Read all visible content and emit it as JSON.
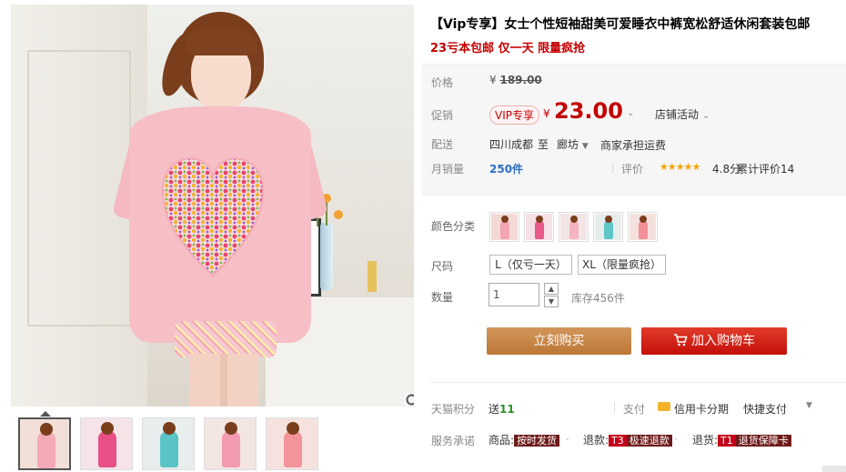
{
  "product": {
    "title": "【Vip专享】女士个性短袖甜美可爱睡衣中裤宽松舒适休闲套装包邮",
    "subtitle": "23亏本包邮 仅一天 限量疯抢"
  },
  "price": {
    "label": "价格",
    "currency": "¥",
    "original": "189.00"
  },
  "promo": {
    "label": "促销",
    "vip_tag": "VIP专享",
    "currency": "¥",
    "price": "23.00",
    "store_event": "店铺活动"
  },
  "shipping": {
    "label": "配送",
    "from": "四川成都",
    "to_word": "至",
    "to": "廊坊",
    "fee": "商家承担运费"
  },
  "sales": {
    "label": "月销量",
    "count": "250件",
    "rating_label": "评价",
    "stars": "★★★★★",
    "rating": "4.8分",
    "cumulative": "累计评价14"
  },
  "color": {
    "label": "颜色分类",
    "options": [
      {
        "name": "swatch-1",
        "bg": "#f4d9d4",
        "body": "#f3a5b1"
      },
      {
        "name": "swatch-2",
        "bg": "#f6e1e6",
        "body": "#e95a8a"
      },
      {
        "name": "swatch-3",
        "bg": "#f3e4e6",
        "body": "#f5b3c0"
      },
      {
        "name": "swatch-4",
        "bg": "#e7ecec",
        "body": "#5cc6c8"
      },
      {
        "name": "swatch-5",
        "bg": "#f4e1de",
        "body": "#f38f98"
      }
    ]
  },
  "size": {
    "label": "尺码",
    "options": [
      "L（仅亏一天）",
      "XL（限量疯抢）"
    ]
  },
  "quantity": {
    "label": "数量",
    "value": "1",
    "stock": "库存456件"
  },
  "buttons": {
    "buy_now": "立刻购买",
    "add_to_cart": "加入购物车"
  },
  "points": {
    "label": "天猫积分",
    "send_word": "送",
    "value": "11",
    "pay_label": "支付",
    "credit": "信用卡分期",
    "quick_pay": "快捷支付"
  },
  "service": {
    "label": "服务承诺",
    "goods_label": "商品:",
    "goods_badge": "按时发货",
    "refund_label": "退款:",
    "refund_code": "T3",
    "refund_badge": "极速退款",
    "return_label": "退货:",
    "return_code": "T1",
    "return_badge": "退货保障卡"
  },
  "colors": {
    "accent_red": "#c40000",
    "buy_button": "#c8893b",
    "cart_button": "#d9241b"
  }
}
